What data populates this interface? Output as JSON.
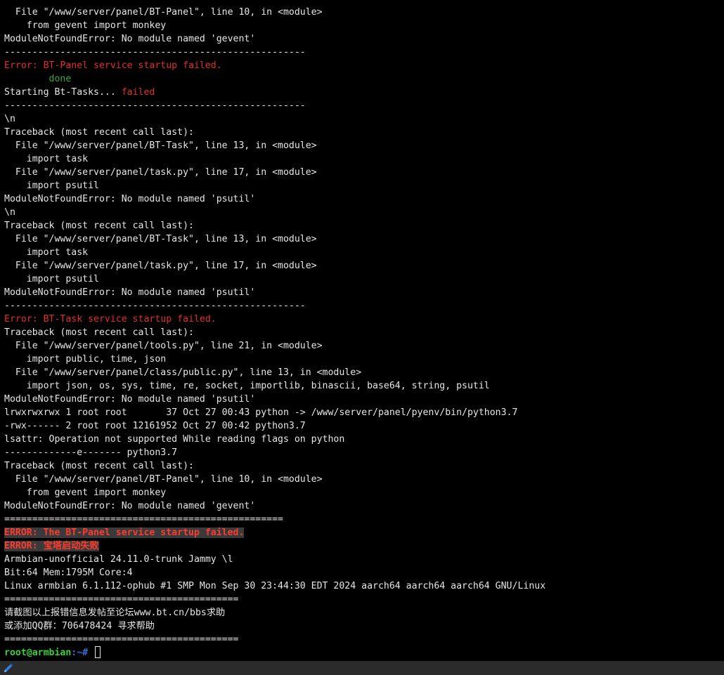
{
  "terminal": {
    "lines": [
      "  File \"/www/server/panel/BT-Panel\", line 10, in <module>",
      "    from gevent import monkey",
      "ModuleNotFoundError: No module named 'gevent'",
      "------------------------------------------------------",
      "Error: BT-Panel service startup failed.",
      "        done",
      [
        "Starting Bt-Tasks... ",
        "failed"
      ],
      "------------------------------------------------------",
      "\\n",
      "Traceback (most recent call last):",
      "  File \"/www/server/panel/BT-Task\", line 13, in <module>",
      "    import task",
      "  File \"/www/server/panel/task.py\", line 17, in <module>",
      "    import psutil",
      "ModuleNotFoundError: No module named 'psutil'",
      "\\n",
      "Traceback (most recent call last):",
      "  File \"/www/server/panel/BT-Task\", line 13, in <module>",
      "    import task",
      "  File \"/www/server/panel/task.py\", line 17, in <module>",
      "    import psutil",
      "ModuleNotFoundError: No module named 'psutil'",
      "------------------------------------------------------",
      "Error: BT-Task service startup failed.",
      "Traceback (most recent call last):",
      "  File \"/www/server/panel/tools.py\", line 21, in <module>",
      "    import public, time, json",
      "  File \"/www/server/panel/class/public.py\", line 13, in <module>",
      "    import json, os, sys, time, re, socket, importlib, binascii, base64, string, psutil",
      "ModuleNotFoundError: No module named 'psutil'",
      "lrwxrwxrwx 1 root root       37 Oct 27 00:43 python -> /www/server/panel/pyenv/bin/python3.7",
      "-rwx------ 2 root root 12161952 Oct 27 00:42 python3.7",
      "lsattr: Operation not supported While reading flags on python",
      "-------------e------- python3.7",
      "Traceback (most recent call last):",
      "  File \"/www/server/panel/BT-Panel\", line 10, in <module>",
      "    from gevent import monkey",
      "ModuleNotFoundError: No module named 'gevent'",
      "==================================================",
      "ERROR: The BT-Panel service startup failed.",
      "ERROR: 宝塔启动失败",
      "Armbian-unofficial 24.11.0-trunk Jammy \\l",
      "Bit:64 Mem:1795M Core:4",
      "Linux armbian 6.1.112-ophub #1 SMP Mon Sep 30 23:44:30 EDT 2024 aarch64 aarch64 aarch64 GNU/Linux",
      "==========================================",
      "请截图以上报错信息发帖至论坛www.bt.cn/bbs求助",
      "或添加QQ群：706478424 寻求帮助",
      "=========================================="
    ],
    "prompt": {
      "user_host": "root@armbian",
      "path_suffix": ":~# "
    }
  },
  "status_bar": {
    "icon": "pencil-icon"
  },
  "colors": {
    "background": "#000000",
    "text": "#e6e6e6",
    "error_red": "#e0302b",
    "done_green": "#3ea33e",
    "highlight_bg": "#3a3a3a",
    "highlight_text": "#ff3b30",
    "prompt_user": "#3ecf3e",
    "prompt_path": "#3a6fe0"
  }
}
